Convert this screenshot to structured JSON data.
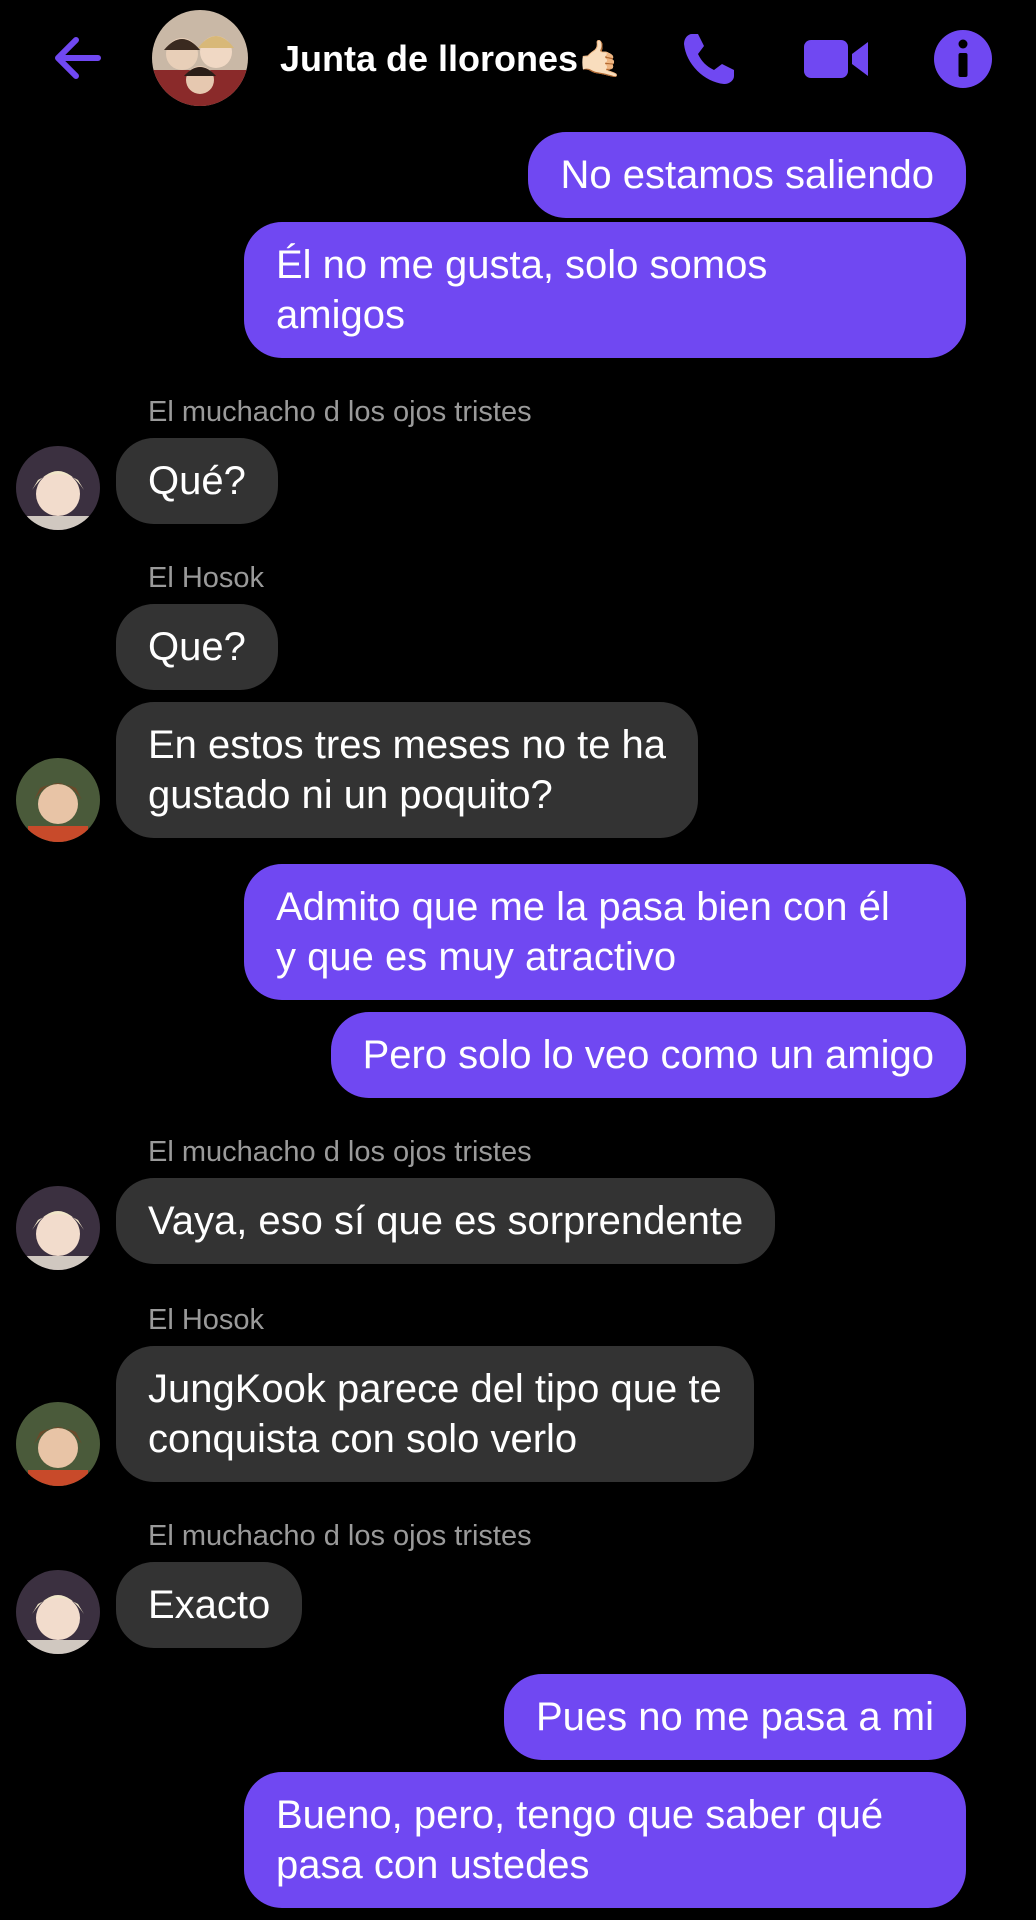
{
  "header": {
    "title": "Junta de llorones",
    "title_emoji": "🤙🏻",
    "accent_color": "#7048f2",
    "icons": [
      "back-arrow-icon",
      "phone-icon",
      "video-camera-icon",
      "info-icon"
    ]
  },
  "colors": {
    "outgoing_bubble": "#7048f2",
    "incoming_bubble": "#333333",
    "background": "#000000",
    "sender_name": "#9a9a9a"
  },
  "senders": {
    "sad_eyes": "El muchacho d los ojos tristes",
    "hosok": "El Hosok"
  },
  "messages": [
    {
      "from": "me",
      "lines": [
        "No estamos saliendo"
      ]
    },
    {
      "from": "me",
      "lines": [
        "Él no me gusta, solo somos",
        "amigos"
      ]
    },
    {
      "from": "El muchacho d los ojos tristes",
      "lines": [
        "Qué?"
      ]
    },
    {
      "from": "El Hosok",
      "lines": [
        "Que?"
      ]
    },
    {
      "from": "El Hosok",
      "lines": [
        "En estos tres meses no te ha",
        "gustado ni un poquito?"
      ]
    },
    {
      "from": "me",
      "lines": [
        "Admito que me la pasa bien con él",
        "y que es muy atractivo"
      ]
    },
    {
      "from": "me",
      "lines": [
        "Pero solo lo veo como un amigo"
      ]
    },
    {
      "from": "El muchacho d los ojos tristes",
      "lines": [
        "Vaya, eso sí que es sorprendente"
      ]
    },
    {
      "from": "El Hosok",
      "lines": [
        "JungKook parece del tipo que te",
        "conquista con solo verlo"
      ]
    },
    {
      "from": "El muchacho d los ojos tristes",
      "lines": [
        "Exacto"
      ]
    },
    {
      "from": "me",
      "lines": [
        "Pues no me pasa a mi"
      ]
    },
    {
      "from": "me",
      "lines": [
        "Bueno, pero, tengo que saber qué",
        "pasa con ustedes"
      ]
    }
  ]
}
